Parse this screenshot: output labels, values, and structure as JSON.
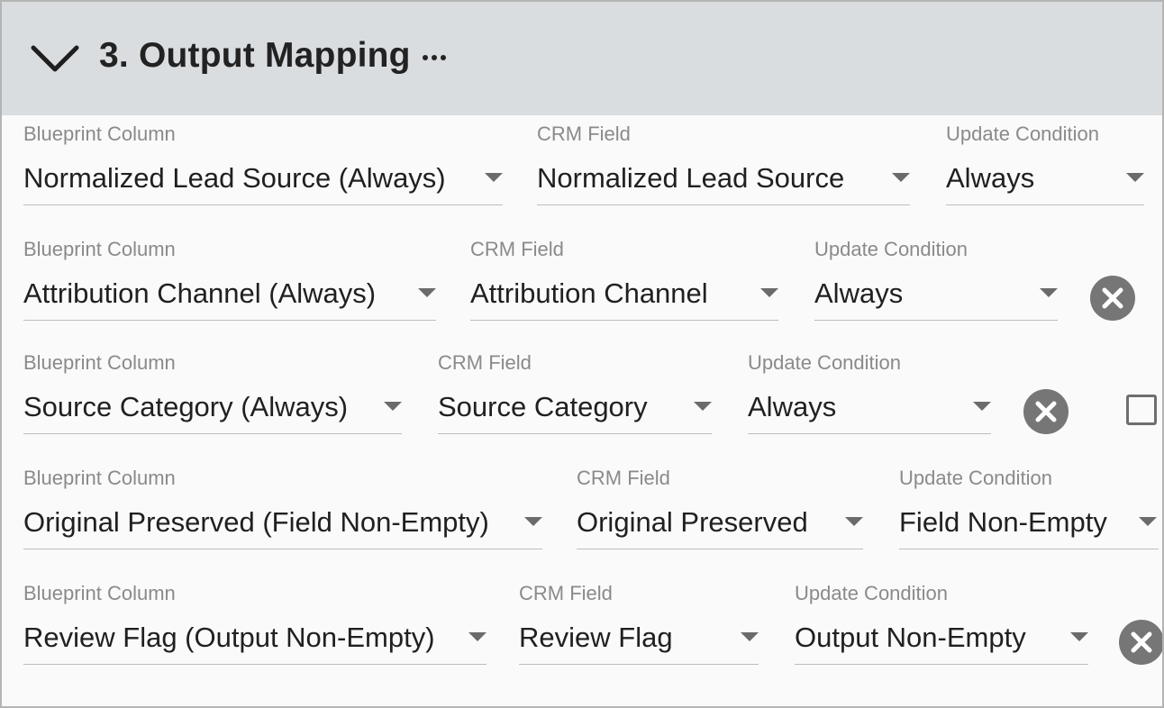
{
  "section": {
    "title": "3. Output Mapping",
    "collapse_icon": "chevron-down-icon",
    "more_icon": "more-horizontal-icon"
  },
  "labels": {
    "blueprint": "Blueprint Column",
    "crm": "CRM Field",
    "condition": "Update Condition"
  },
  "mappings": [
    {
      "blueprint_column": "Normalized Lead Source (Always)",
      "crm_field": "Normalized Lead Source",
      "update_condition": "Always"
    },
    {
      "blueprint_column": "Attribution Channel (Always)",
      "crm_field": "Attribution Channel",
      "update_condition": "Always"
    },
    {
      "blueprint_column": "Source Category (Always)",
      "crm_field": "Source Category",
      "update_condition": "Always"
    },
    {
      "blueprint_column": "Original Preserved (Field Non-Empty)",
      "crm_field": "Original Preserved",
      "update_condition": "Field Non-Empty"
    },
    {
      "blueprint_column": "Review Flag (Output Non-Empty)",
      "crm_field": "Review Flag",
      "update_condition": "Output Non-Empty"
    }
  ],
  "colors": {
    "header_bg": "#dadde0",
    "remove_button": "#767676",
    "label": "#8a8a8a"
  }
}
